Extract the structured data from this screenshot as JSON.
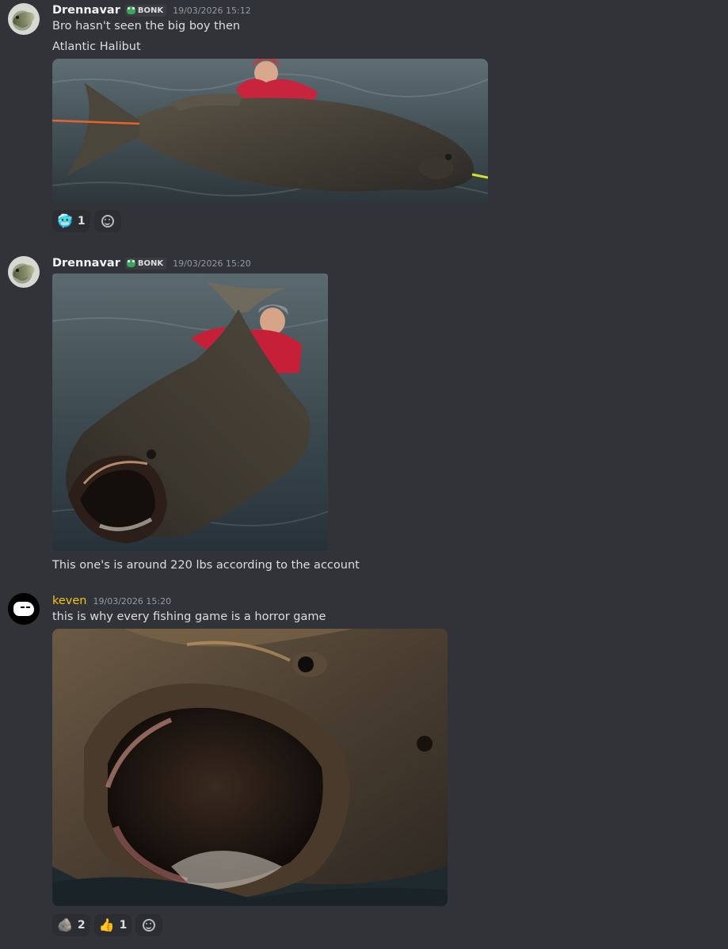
{
  "messages": [
    {
      "author": "Drennavar",
      "tag": "BONK",
      "timestamp": "19/03/2026 15:12",
      "lines": [
        "Bro hasn't seen the big boy then",
        "Atlantic Halibut"
      ],
      "reactions": [
        {
          "emoji": "🥶",
          "emoji_name": "cold-face-icon",
          "count": "1"
        }
      ]
    },
    {
      "author": "Drennavar",
      "tag": "BONK",
      "timestamp": "19/03/2026 15:20",
      "lines": [
        "This one's is around 220 lbs according to the account"
      ],
      "reactions": []
    },
    {
      "author": "keven",
      "timestamp": "19/03/2026 15:20",
      "lines": [
        "this is why every fishing game is a horror game"
      ],
      "reactions": [
        {
          "emoji": "🪨",
          "emoji_name": "rock-icon",
          "count": "2"
        },
        {
          "emoji": "👍",
          "emoji_name": "thumbs-up-icon",
          "count": "1"
        }
      ]
    }
  ],
  "colors": {
    "background": "#313338",
    "text": "#dbdee1",
    "username": "#f2f3f5",
    "username_keven": "#f0c519",
    "timestamp": "#949ba4",
    "reaction_bg": "#2b2d31"
  }
}
